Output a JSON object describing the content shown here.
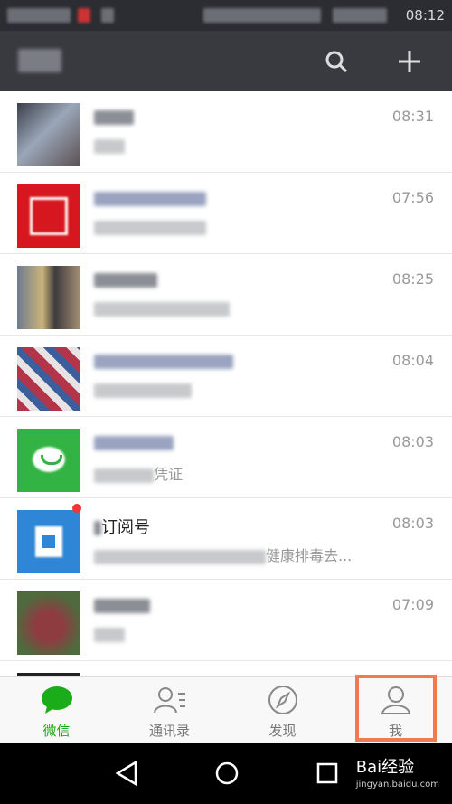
{
  "status_bar": {
    "time": "08:12"
  },
  "chats": [
    {
      "name": "",
      "message": "",
      "time": "08:31",
      "avatar_color": "#6b7a8f"
    },
    {
      "name": "",
      "message": "",
      "time": "07:56",
      "avatar_color": "#d7171f"
    },
    {
      "name": "",
      "message": "",
      "time": "08:25",
      "avatar_color": "#8a7a63"
    },
    {
      "name": "",
      "message": "",
      "time": "08:04",
      "avatar_color": "#b2354a"
    },
    {
      "name": "",
      "message": "凭证",
      "time": "08:03",
      "avatar_color": "#33b343"
    },
    {
      "name": "订阅号",
      "message": "健康排毒去...",
      "time": "08:03",
      "avatar_color": "#2f86d7"
    },
    {
      "name": "",
      "message": "",
      "time": "07:09",
      "avatar_color": "#8e3c40"
    }
  ],
  "tabs": [
    {
      "label": "微信",
      "icon": "chat-bubble-icon",
      "active": true
    },
    {
      "label": "通讯录",
      "icon": "contacts-icon",
      "active": false
    },
    {
      "label": "发现",
      "icon": "compass-icon",
      "active": false
    },
    {
      "label": "我",
      "icon": "person-icon",
      "active": false
    }
  ],
  "watermark": {
    "brand": "Bai经验",
    "url": "jingyan.baidu.com"
  },
  "colors": {
    "accent": "#1aad19",
    "appbar": "#393a3f",
    "highlight": "#ef7b51"
  }
}
